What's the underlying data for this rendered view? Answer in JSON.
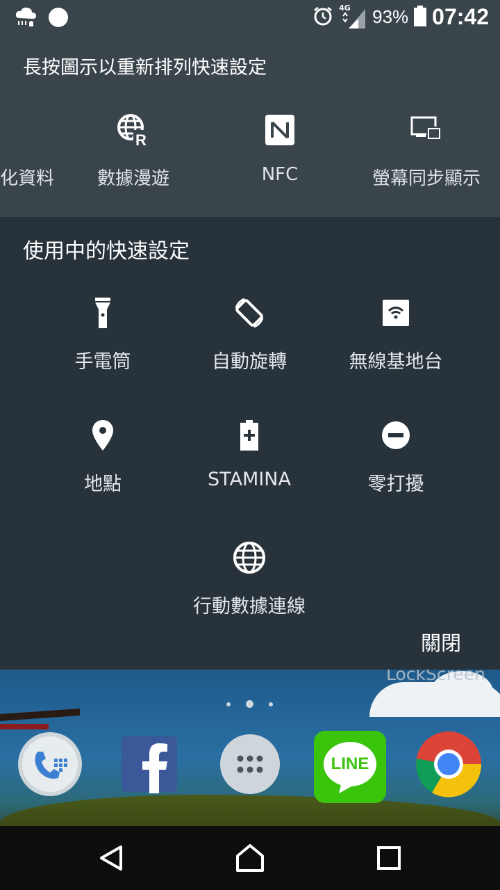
{
  "status_bar": {
    "network": "4G",
    "battery_percent": "93%",
    "time": "07:42"
  },
  "edit_panel": {
    "hint": "長按圖示以重新排列快速設定",
    "tiles": [
      {
        "label": "化資料",
        "icon": "partial-icon"
      },
      {
        "label": "數據漫遊",
        "icon": "data-roaming-icon"
      },
      {
        "label": "NFC",
        "icon": "nfc-icon"
      },
      {
        "label": "螢幕同步顯示",
        "icon": "screen-mirroring-icon"
      }
    ]
  },
  "active_panel": {
    "title": "使用中的快速設定",
    "tiles": [
      {
        "label": "手電筒",
        "icon": "flashlight-icon"
      },
      {
        "label": "自動旋轉",
        "icon": "auto-rotate-icon"
      },
      {
        "label": "無線基地台",
        "icon": "hotspot-icon"
      },
      {
        "label": "地點",
        "icon": "location-icon"
      },
      {
        "label": "STAMINA",
        "icon": "stamina-battery-icon"
      },
      {
        "label": "零打擾",
        "icon": "do-not-disturb-icon"
      },
      {
        "label": "行動數據連線",
        "icon": "mobile-data-globe-icon"
      }
    ],
    "close_label": "關閉"
  },
  "home": {
    "widget_text": "LockScreen",
    "dock_apps": [
      {
        "name": "Phone",
        "icon": "phone-icon"
      },
      {
        "name": "Facebook",
        "icon": "facebook-icon"
      },
      {
        "name": "Apps",
        "icon": "app-drawer-icon"
      },
      {
        "name": "LINE",
        "icon": "line-icon",
        "text": "LINE"
      },
      {
        "name": "Chrome",
        "icon": "chrome-icon"
      }
    ]
  },
  "colors": {
    "panel_top": "#3a444b",
    "panel_active": "#27323a",
    "line_green": "#3ac40c"
  }
}
